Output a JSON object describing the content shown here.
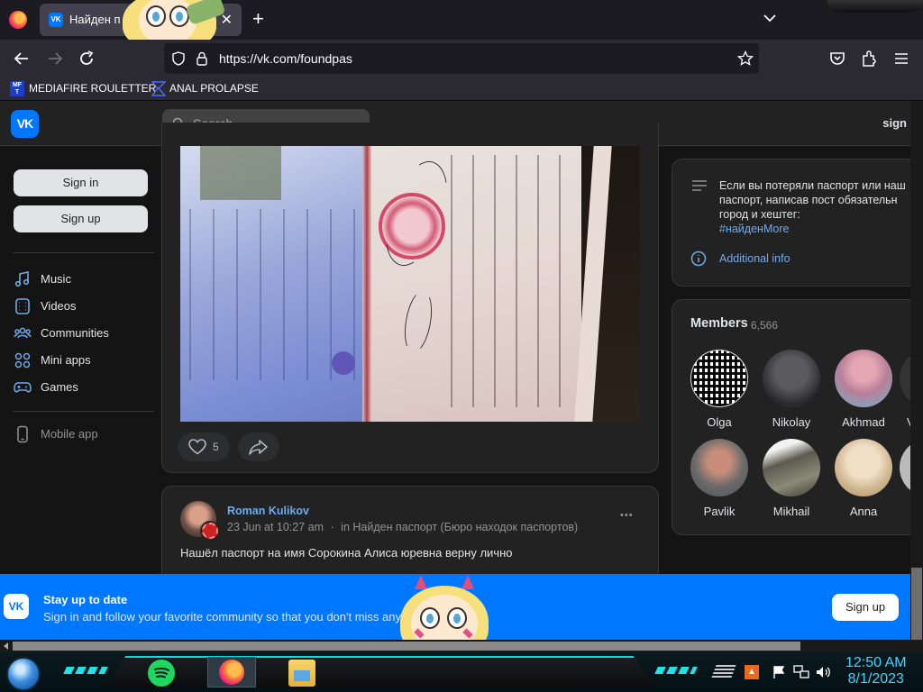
{
  "browser": {
    "tab_title": "Найден п",
    "tab_close": "✕",
    "new_tab": "+",
    "url": "https://vk.com/foundpas",
    "bookmarks": [
      {
        "label": "MEDIAFIRE ROULETTER"
      },
      {
        "label": "ANAL PROLAPSE"
      }
    ]
  },
  "vk": {
    "logo": "VK",
    "search_placeholder": "Search",
    "header_sign": "sign"
  },
  "leftnav": {
    "sign_in": "Sign in",
    "sign_up": "Sign up",
    "items": [
      {
        "label": "Music",
        "icon": "music-icon"
      },
      {
        "label": "Videos",
        "icon": "videos-icon"
      },
      {
        "label": "Communities",
        "icon": "communities-icon"
      },
      {
        "label": "Mini apps",
        "icon": "mini-apps-icon"
      },
      {
        "label": "Games",
        "icon": "games-icon"
      }
    ],
    "mobile_app": "Mobile app"
  },
  "post1": {
    "likes": "5"
  },
  "post2": {
    "author": "Roman Kulikov",
    "date": "23 Jun at 10:27 am",
    "in_prefix": "in",
    "community": "Найден паспорт (Бюро находок паспортов)",
    "text": "Нашёл паспорт на имя Сорокина Алиса юревна верну лично",
    "more": "•••"
  },
  "about": {
    "text": "Если вы потеряли паспорт или наш паспорт, написав пост обязательн город и хештег:",
    "hashtag": "#найден",
    "more": "More",
    "additional_info": "Additional info"
  },
  "members": {
    "title": "Members",
    "count": "6,566",
    "people": [
      {
        "name": "Olga"
      },
      {
        "name": "Nikolay"
      },
      {
        "name": "Akhmad"
      },
      {
        "name": "V"
      },
      {
        "name": "Pavlik"
      },
      {
        "name": "Mikhail"
      },
      {
        "name": "Anna"
      }
    ]
  },
  "banner": {
    "logo": "VK",
    "title": "Stay up to date",
    "subtitle": "Sign in and follow your favorite community so that you don't miss any",
    "sign_up": "Sign up"
  },
  "taskbar": {
    "time": "12:50 AM",
    "date": "8/1/2023"
  },
  "colors": {
    "vk_blue": "#0077ff",
    "link": "#71aaeb",
    "page_bg": "#141414",
    "card_bg": "#222222"
  }
}
